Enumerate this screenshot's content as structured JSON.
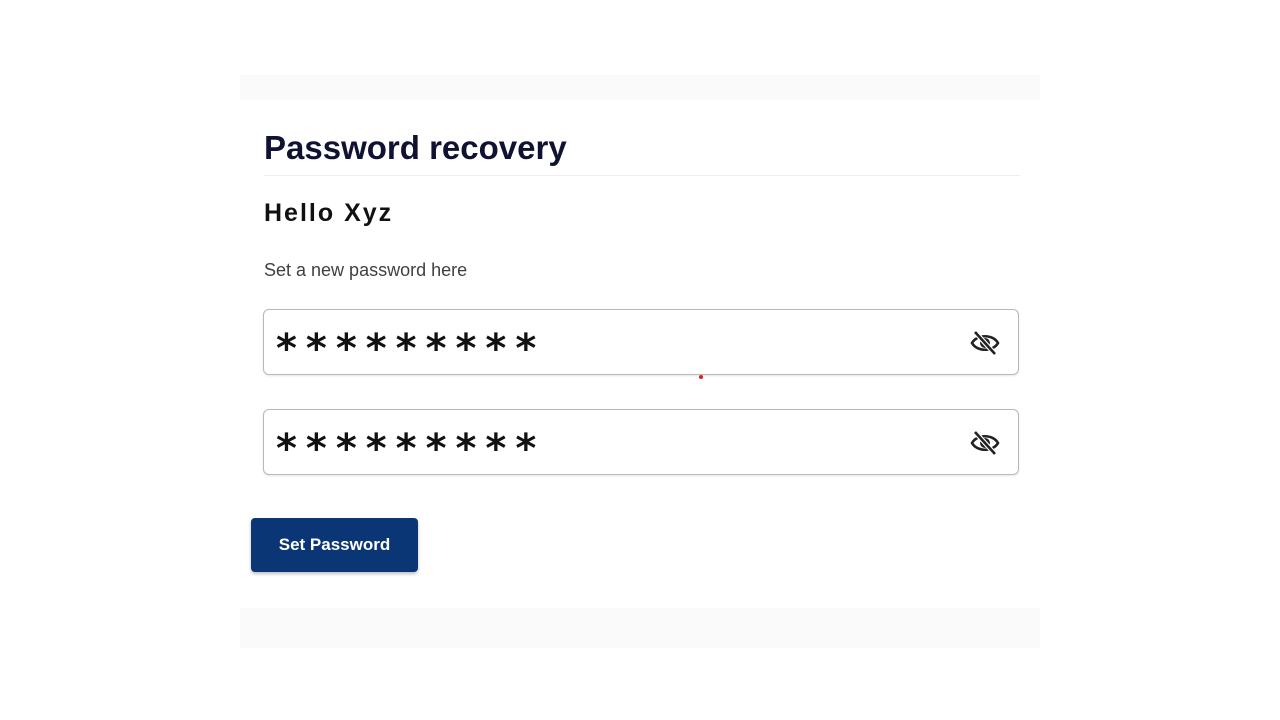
{
  "recovery": {
    "title": "Password recovery",
    "greeting": "Hello Xyz",
    "instruction": "Set a new password here",
    "password_field": {
      "masked_value": "*********",
      "toggle_icon": "eye-slash-icon"
    },
    "confirm_field": {
      "masked_value": "*********",
      "toggle_icon": "eye-slash-icon"
    },
    "submit_label": "Set Password"
  },
  "colors": {
    "button_background": "#0a3675",
    "title_text": "#0f1230",
    "field_border": "#b9b9b9"
  }
}
